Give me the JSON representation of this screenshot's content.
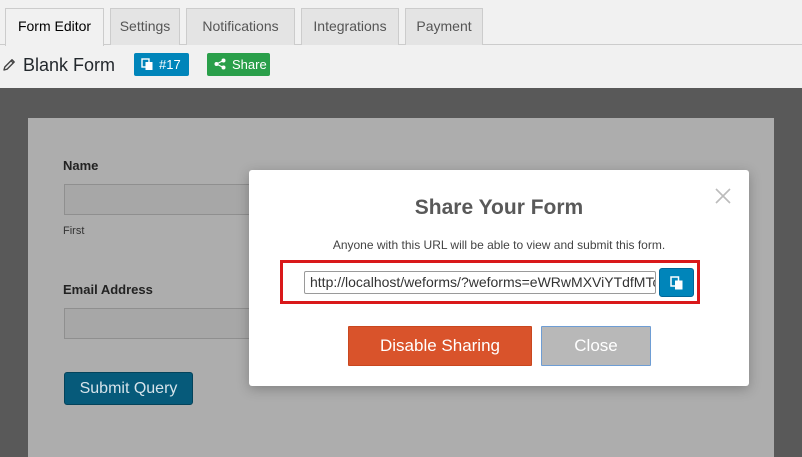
{
  "tabs": [
    {
      "label": "Form Editor",
      "active": true
    },
    {
      "label": "Settings",
      "active": false
    },
    {
      "label": "Notifications",
      "active": false
    },
    {
      "label": "Integrations",
      "active": false
    },
    {
      "label": "Payment",
      "active": false
    }
  ],
  "header": {
    "form_title": "Blank Form",
    "id_badge": "#17",
    "share_badge": "Share"
  },
  "preview": {
    "name_label": "Name",
    "first_sublabel": "First",
    "email_label": "Email Address",
    "submit_label": "Submit Query"
  },
  "modal": {
    "title": "Share Your Form",
    "description": "Anyone with this URL will be able to view and submit this form.",
    "url_value": "http://localhost/weforms/?weforms=eWRwMXViYTdfMTc",
    "disable_label": "Disable Sharing",
    "close_label": "Close"
  },
  "colors": {
    "primary_blue": "#0085ba",
    "share_green": "#2a9f4a",
    "disable_orange": "#d9532b",
    "highlight_red": "#d9181a"
  }
}
